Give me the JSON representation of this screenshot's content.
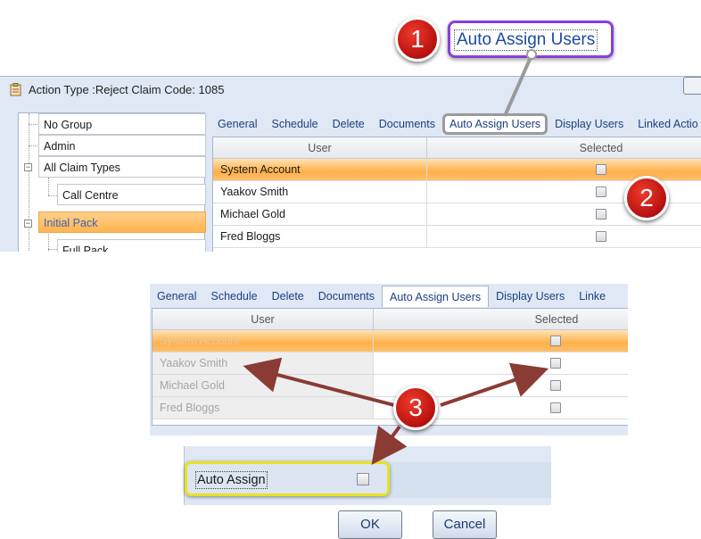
{
  "callouts": {
    "badge1": "1",
    "badge2": "2",
    "badge3": "3",
    "top_label": "Auto Assign Users"
  },
  "window": {
    "title": "Action Type :Reject Claim Code: 1085",
    "icon": "clipboard-icon"
  },
  "tree": {
    "items": [
      "No Group",
      "Admin",
      "All Claim Types",
      "Call Centre",
      "Initial Pack",
      "Full Pack"
    ],
    "selected": "Initial Pack"
  },
  "tabs_top": [
    "General",
    "Schedule",
    "Delete",
    "Documents",
    "Auto Assign Users",
    "Display Users",
    "Linked Actio"
  ],
  "tabs_bottom": [
    "General",
    "Schedule",
    "Delete",
    "Documents",
    "Auto Assign Users",
    "Display Users",
    "Linke"
  ],
  "grid": {
    "columns": [
      "User",
      "Selected"
    ],
    "rows": [
      {
        "user": "System Account",
        "selected": false
      },
      {
        "user": "Yaakov Smith",
        "selected": false
      },
      {
        "user": "Michael Gold",
        "selected": false
      },
      {
        "user": "Fred Bloggs",
        "selected": false
      }
    ]
  },
  "auto_assign": {
    "label": "Auto Assign",
    "checked": false
  },
  "buttons": {
    "ok": "OK",
    "cancel": "Cancel"
  },
  "colors": {
    "badge_red": "#d01c1c",
    "callout_purple": "#8a3fd8",
    "highlight_yellow": "#e8e222",
    "selection_orange": "#ffb04a",
    "arrow_brown": "#8a3b34"
  }
}
